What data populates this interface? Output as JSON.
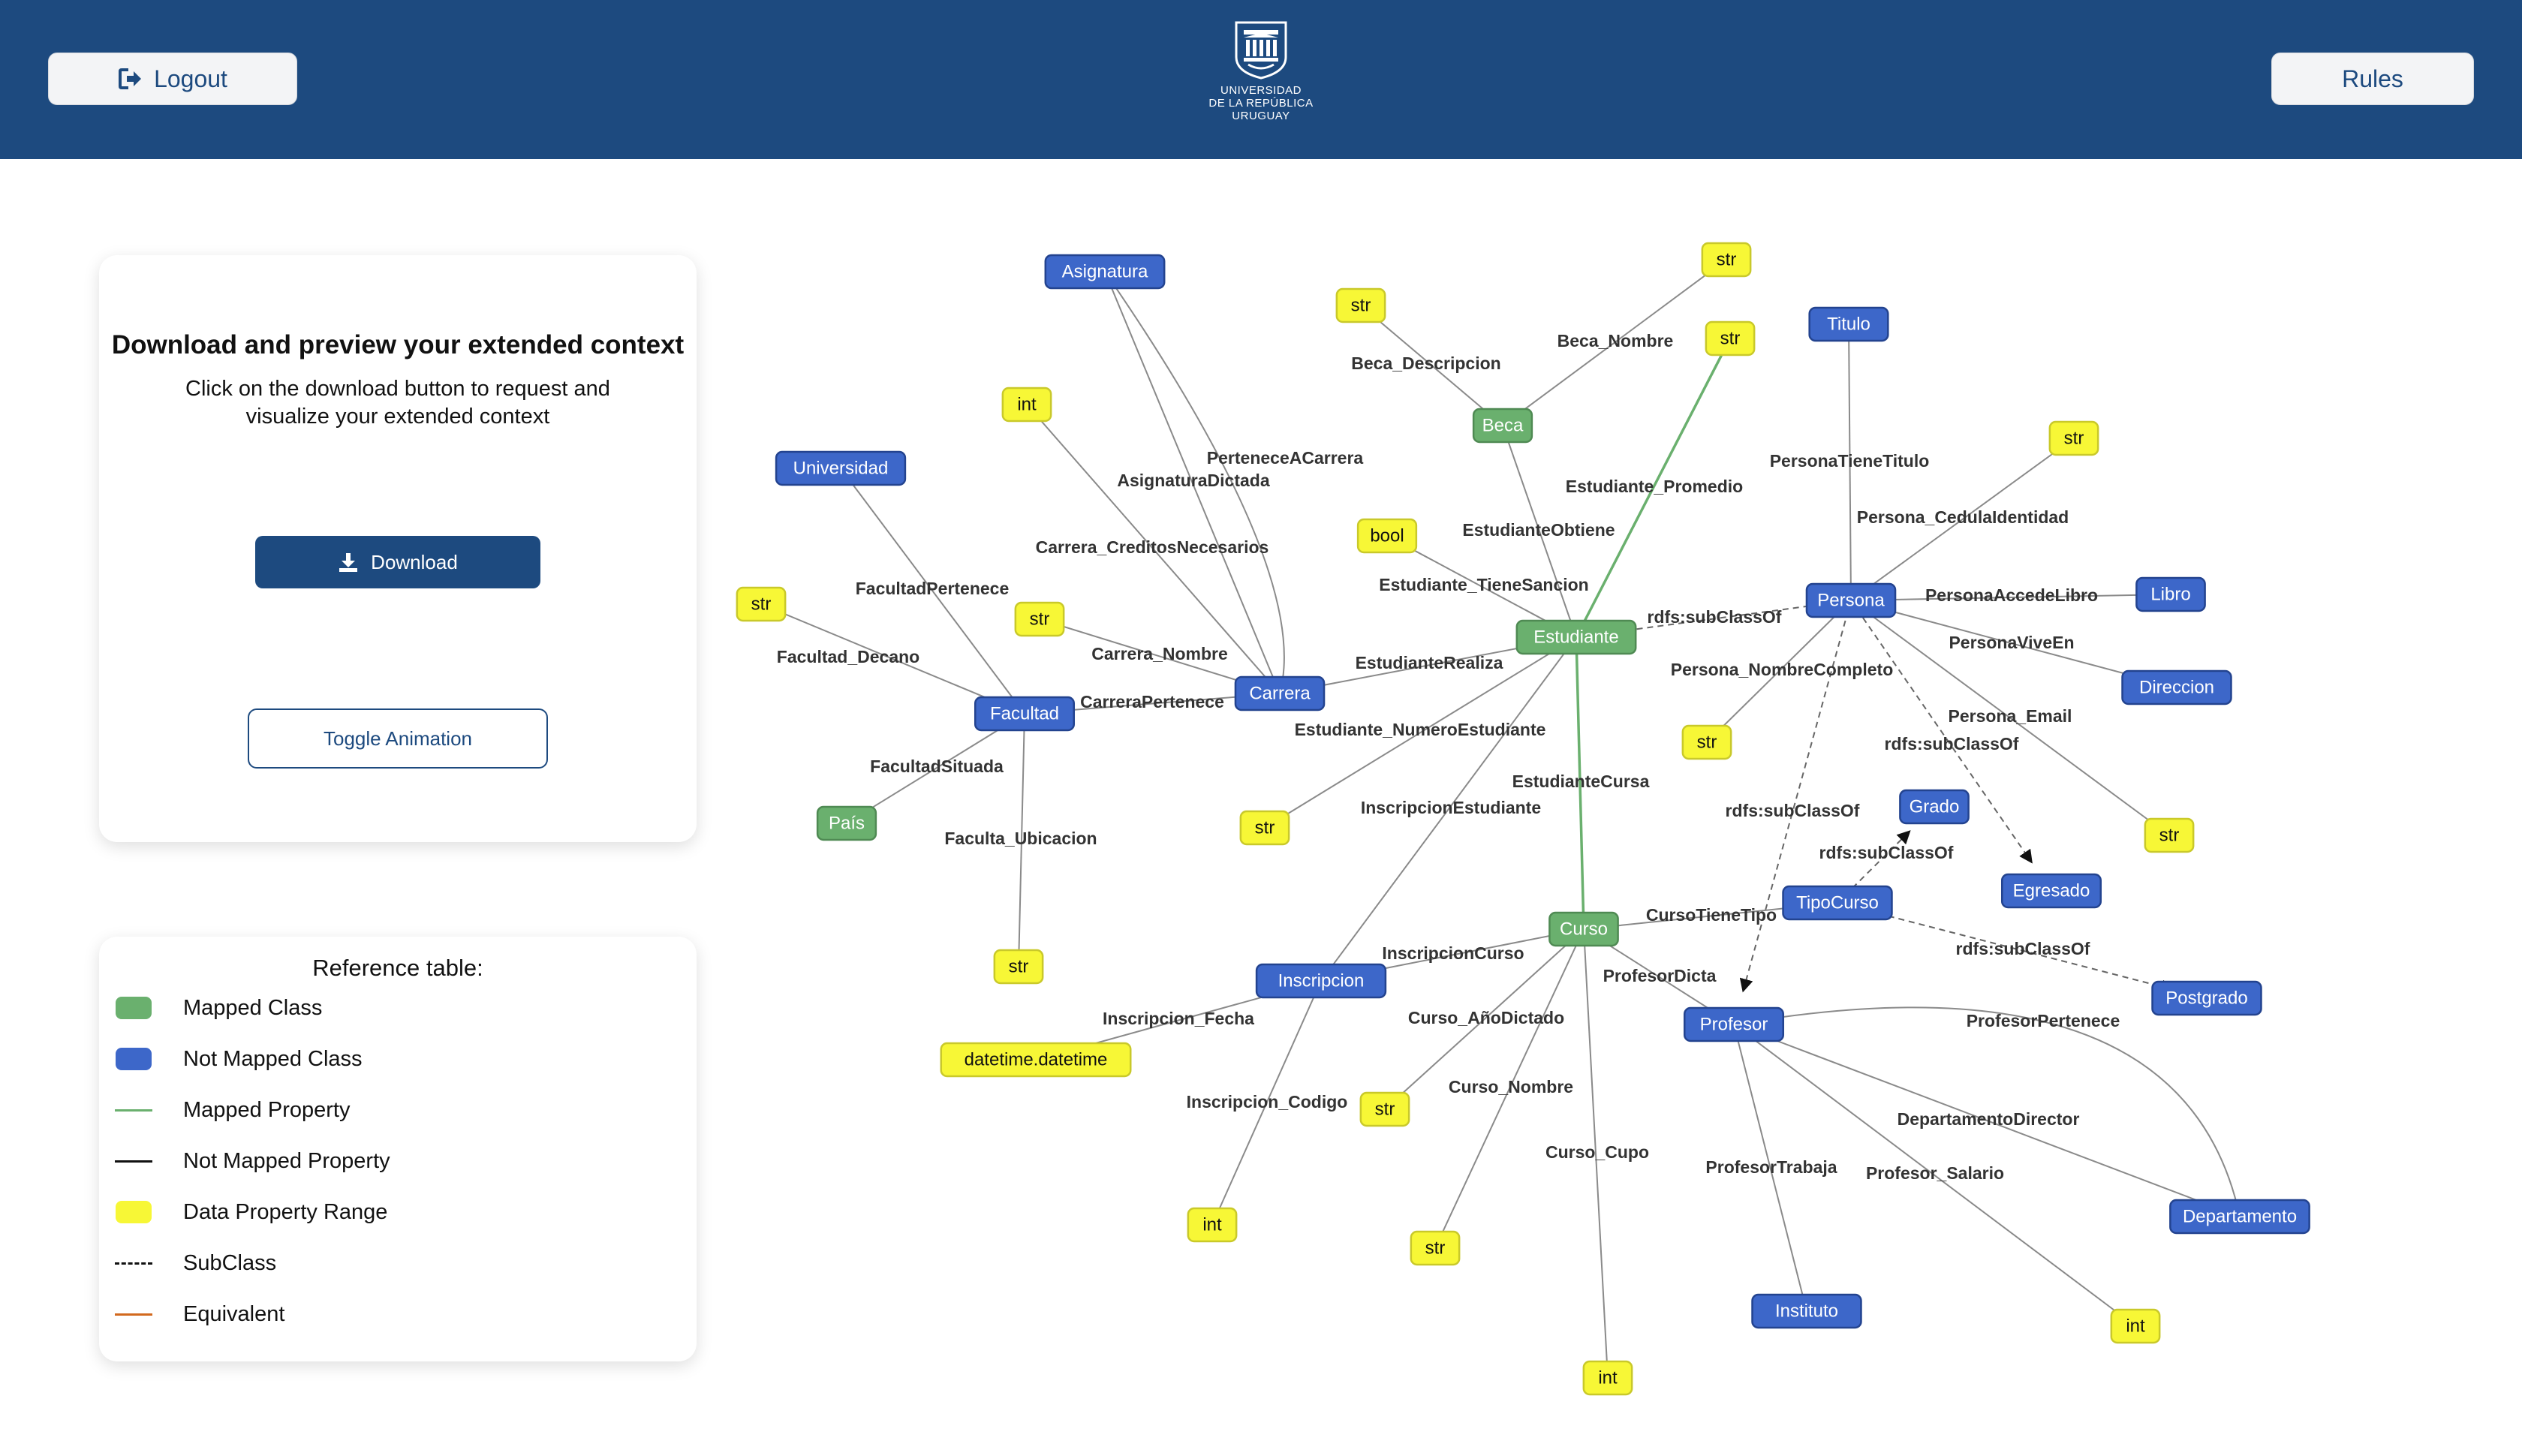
{
  "header": {
    "logout_label": "Logout",
    "rules_label": "Rules",
    "logo_lines": [
      "UNIVERSIDAD",
      "DE LA REPÚBLICA",
      "URUGUAY"
    ]
  },
  "download_card": {
    "title": "Download and preview your extended context",
    "subtitle": "Click on the download button to request and visualize your extended context",
    "download_label": "Download",
    "toggle_label": "Toggle Animation"
  },
  "reference": {
    "title": "Reference table:",
    "items": [
      {
        "label": "Mapped Class",
        "kind": "box",
        "color": "#6ab06e"
      },
      {
        "label": "Not Mapped Class",
        "kind": "box",
        "color": "#3d67c9"
      },
      {
        "label": "Mapped Property",
        "kind": "line",
        "color": "#6ab06e"
      },
      {
        "label": "Not Mapped Property",
        "kind": "line",
        "color": "#111111"
      },
      {
        "label": "Data Property Range",
        "kind": "box",
        "color": "#f7f736"
      },
      {
        "label": "SubClass",
        "kind": "dashed",
        "color": "#111111"
      },
      {
        "label": "Equivalent",
        "kind": "line",
        "color": "#d2691e"
      }
    ]
  },
  "graph": {
    "colors": {
      "mapped": "#6ab06e",
      "not_mapped": "#3d67c9",
      "data": "#f7f736"
    },
    "nodes": [
      {
        "id": "Asignatura",
        "label": "Asignatura",
        "type": "not_mapped"
      },
      {
        "id": "Universidad",
        "label": "Universidad",
        "type": "not_mapped"
      },
      {
        "id": "Facultad",
        "label": "Facultad",
        "type": "not_mapped"
      },
      {
        "id": "Pais",
        "label": "País",
        "type": "mapped"
      },
      {
        "id": "Carrera",
        "label": "Carrera",
        "type": "not_mapped"
      },
      {
        "id": "Beca",
        "label": "Beca",
        "type": "mapped"
      },
      {
        "id": "Estudiante",
        "label": "Estudiante",
        "type": "mapped"
      },
      {
        "id": "Curso",
        "label": "Curso",
        "type": "mapped"
      },
      {
        "id": "Inscripcion",
        "label": "Inscripcion",
        "type": "not_mapped"
      },
      {
        "id": "Titulo",
        "label": "Titulo",
        "type": "not_mapped"
      },
      {
        "id": "Persona",
        "label": "Persona",
        "type": "not_mapped"
      },
      {
        "id": "Libro",
        "label": "Libro",
        "type": "not_mapped"
      },
      {
        "id": "Direccion",
        "label": "Direccion",
        "type": "not_mapped"
      },
      {
        "id": "Grado",
        "label": "Grado",
        "type": "not_mapped"
      },
      {
        "id": "TipoCurso",
        "label": "TipoCurso",
        "type": "not_mapped"
      },
      {
        "id": "Egresado",
        "label": "Egresado",
        "type": "not_mapped"
      },
      {
        "id": "Postgrado",
        "label": "Postgrado",
        "type": "not_mapped"
      },
      {
        "id": "Profesor",
        "label": "Profesor",
        "type": "not_mapped"
      },
      {
        "id": "Departamento",
        "label": "Departamento",
        "type": "not_mapped"
      },
      {
        "id": "Instituto",
        "label": "Instituto",
        "type": "not_mapped"
      },
      {
        "id": "d_int_asig",
        "label": "int",
        "type": "data"
      },
      {
        "id": "d_str_fac",
        "label": "str",
        "type": "data"
      },
      {
        "id": "d_str_car",
        "label": "str",
        "type": "data"
      },
      {
        "id": "d_str_facub",
        "label": "str",
        "type": "data"
      },
      {
        "id": "d_str_becadesc",
        "label": "str",
        "type": "data"
      },
      {
        "id": "d_str_becanom",
        "label": "str",
        "type": "data"
      },
      {
        "id": "d_str_prom",
        "label": "str",
        "type": "data"
      },
      {
        "id": "d_bool",
        "label": "bool",
        "type": "data"
      },
      {
        "id": "d_str_numest",
        "label": "str",
        "type": "data"
      },
      {
        "id": "d_str_cedula",
        "label": "str",
        "type": "data"
      },
      {
        "id": "d_str_nomcomp",
        "label": "str",
        "type": "data"
      },
      {
        "id": "d_str_email",
        "label": "str",
        "type": "data"
      },
      {
        "id": "d_datetime",
        "label": "datetime.datetime",
        "type": "data"
      },
      {
        "id": "d_int_insc",
        "label": "int",
        "type": "data"
      },
      {
        "id": "d_str_anio",
        "label": "str",
        "type": "data"
      },
      {
        "id": "d_str_cnom",
        "label": "str",
        "type": "data"
      },
      {
        "id": "d_int_cupo",
        "label": "int",
        "type": "data"
      },
      {
        "id": "d_int_sal",
        "label": "int",
        "type": "data"
      }
    ],
    "edges": [
      {
        "from": "Asignatura",
        "to": "Carrera",
        "label": "AsignaturaDictada",
        "kind": "plain"
      },
      {
        "from": "Asignatura",
        "to": "Carrera",
        "label": "PerteneceACarrera",
        "kind": "plain"
      },
      {
        "from": "d_int_asig",
        "to": "Carrera",
        "label": "Carrera_CreditosNecesarios",
        "kind": "plain"
      },
      {
        "from": "d_str_car",
        "to": "Carrera",
        "label": "Carrera_Nombre",
        "kind": "plain"
      },
      {
        "from": "Universidad",
        "to": "Facultad",
        "label": "FacultadPertenece",
        "kind": "plain"
      },
      {
        "from": "d_str_fac",
        "to": "Facultad",
        "label": "Facultad_Decano",
        "kind": "plain"
      },
      {
        "from": "Facultad",
        "to": "Carrera",
        "label": "CarreraPertenece",
        "kind": "plain"
      },
      {
        "from": "Facultad",
        "to": "Pais",
        "label": "FacultadSituada",
        "kind": "plain"
      },
      {
        "from": "Facultad",
        "to": "d_str_facub",
        "label": "Faculta_Ubicacion",
        "kind": "plain"
      },
      {
        "from": "Carrera",
        "to": "Estudiante",
        "label": "EstudianteRealiza",
        "kind": "plain"
      },
      {
        "from": "d_str_becadesc",
        "to": "Beca",
        "label": "Beca_Descripcion",
        "kind": "plain"
      },
      {
        "from": "d_str_becanom",
        "to": "Beca",
        "label": "Beca_Nombre",
        "kind": "plain"
      },
      {
        "from": "Beca",
        "to": "Estudiante",
        "label": "EstudianteObtiene",
        "kind": "plain"
      },
      {
        "from": "d_str_prom",
        "to": "Estudiante",
        "label": "Estudiante_Promedio",
        "kind": "mapped"
      },
      {
        "from": "d_bool",
        "to": "Estudiante",
        "label": "Estudiante_TieneSancion",
        "kind": "plain"
      },
      {
        "from": "Estudiante",
        "to": "d_str_numest",
        "label": "Estudiante_NumeroEstudiante",
        "kind": "plain"
      },
      {
        "from": "Estudiante",
        "to": "Inscripcion",
        "label": "InscripcionEstudiante",
        "kind": "plain"
      },
      {
        "from": "Estudiante",
        "to": "Curso",
        "label": "EstudianteCursa",
        "kind": "mapped"
      },
      {
        "from": "Persona",
        "to": "Estudiante",
        "label": "rdfs:subClassOf",
        "kind": "subclass"
      },
      {
        "from": "Titulo",
        "to": "Persona",
        "label": "PersonaTieneTitulo",
        "kind": "plain"
      },
      {
        "from": "d_str_cedula",
        "to": "Persona",
        "label": "Persona_CedulaIdentidad",
        "kind": "plain"
      },
      {
        "from": "Persona",
        "to": "Libro",
        "label": "PersonaAccedeLibro",
        "kind": "plain"
      },
      {
        "from": "Persona",
        "to": "Direccion",
        "label": "PersonaViveEn",
        "kind": "plain"
      },
      {
        "from": "Persona",
        "to": "d_str_nomcomp",
        "label": "Persona_NombreCompleto",
        "kind": "plain"
      },
      {
        "from": "Persona",
        "to": "d_str_email",
        "label": "Persona_Email",
        "kind": "plain"
      },
      {
        "from": "Persona",
        "to": "Egresado",
        "label": "rdfs:subClassOf",
        "kind": "subclass"
      },
      {
        "from": "Persona",
        "to": "Profesor",
        "label": "rdfs:subClassOf",
        "kind": "subclass"
      },
      {
        "from": "TipoCurso",
        "to": "Grado",
        "label": "rdfs:subClassOf",
        "kind": "subclass"
      },
      {
        "from": "TipoCurso",
        "to": "Postgrado",
        "label": "rdfs:subClassOf",
        "kind": "subclass"
      },
      {
        "from": "Curso",
        "to": "TipoCurso",
        "label": "CursoTieneTipo",
        "kind": "plain"
      },
      {
        "from": "Curso",
        "to": "Inscripcion",
        "label": "InscripcionCurso",
        "kind": "plain"
      },
      {
        "from": "Curso",
        "to": "Profesor",
        "label": "ProfesorDicta",
        "kind": "plain"
      },
      {
        "from": "Curso",
        "to": "d_str_anio",
        "label": "Curso_AñoDictado",
        "kind": "plain"
      },
      {
        "from": "Curso",
        "to": "d_str_cnom",
        "label": "Curso_Nombre",
        "kind": "plain"
      },
      {
        "from": "Curso",
        "to": "d_int_cupo",
        "label": "Curso_Cupo",
        "kind": "plain"
      },
      {
        "from": "Inscripcion",
        "to": "d_datetime",
        "label": "Inscripcion_Fecha",
        "kind": "plain"
      },
      {
        "from": "Inscripcion",
        "to": "d_int_insc",
        "label": "Inscripcion_Codigo",
        "kind": "plain"
      },
      {
        "from": "Profesor",
        "to": "Departamento",
        "label": "ProfesorPertenece",
        "kind": "plain"
      },
      {
        "from": "Profesor",
        "to": "Departamento",
        "label": "DepartamentoDirector",
        "kind": "plain"
      },
      {
        "from": "Profesor",
        "to": "Instituto",
        "label": "ProfesorTrabaja",
        "kind": "plain"
      },
      {
        "from": "Profesor",
        "to": "d_int_sal",
        "label": "Profesor_Salario",
        "kind": "plain"
      }
    ]
  }
}
